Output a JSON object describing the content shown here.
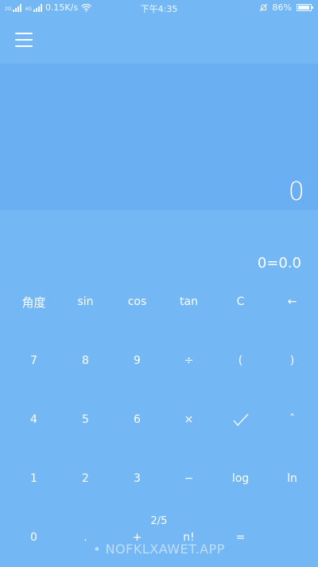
{
  "status_bar": {
    "sig1_label": "2G",
    "sig2_label": "4G",
    "speed": "0.15K/s",
    "wifi_icon": "wifi-icon",
    "time": "下午4:35",
    "alarm_icon": "alarm-off-icon",
    "battery_percent": "86%",
    "battery_level": 0.86
  },
  "menu_icon": "hamburger-menu-icon",
  "display": {
    "value": "0",
    "result": "0=0.0"
  },
  "keypad": {
    "rows": [
      [
        "角度",
        "sin",
        "cos",
        "tan",
        "C",
        "←"
      ],
      [
        "7",
        "8",
        "9",
        "÷",
        "(",
        ")"
      ],
      [
        "4",
        "5",
        "6",
        "×",
        "✓",
        "ˆ"
      ],
      [
        "1",
        "2",
        "3",
        "−",
        "log",
        "ln"
      ],
      [
        "0",
        ".",
        "+",
        "n!",
        "=",
        ""
      ]
    ]
  },
  "page_indicator": "2/5",
  "watermark": "• NOFKLXAWET.APP"
}
